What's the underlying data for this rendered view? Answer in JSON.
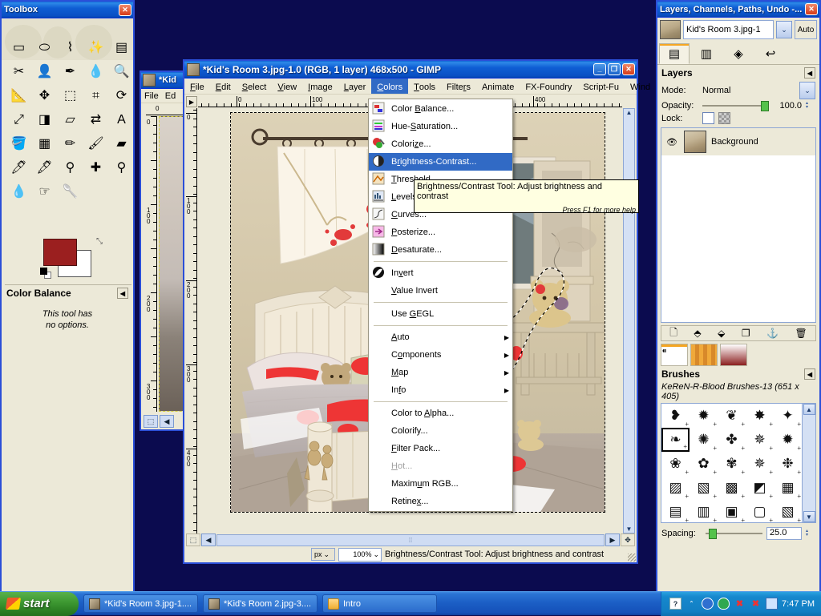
{
  "toolbox": {
    "title": "Toolbox",
    "close_label": "✕",
    "tools": [
      {
        "name": "rect-select-tool",
        "glyph": "▭"
      },
      {
        "name": "ellipse-select-tool",
        "glyph": "⬭"
      },
      {
        "name": "free-select-tool",
        "glyph": "⌇"
      },
      {
        "name": "fuzzy-select-tool",
        "glyph": "✨"
      },
      {
        "name": "select-by-color-tool",
        "glyph": "▤"
      },
      {
        "name": "scissors-select-tool",
        "glyph": "✂"
      },
      {
        "name": "foreground-select-tool",
        "glyph": "👤"
      },
      {
        "name": "paths-tool",
        "glyph": "✒"
      },
      {
        "name": "color-picker-tool",
        "glyph": "💧"
      },
      {
        "name": "zoom-tool",
        "glyph": "🔍"
      },
      {
        "name": "measure-tool",
        "glyph": "📐"
      },
      {
        "name": "move-tool",
        "glyph": "✥"
      },
      {
        "name": "align-tool",
        "glyph": "⬚"
      },
      {
        "name": "crop-tool",
        "glyph": "⌗"
      },
      {
        "name": "rotate-tool",
        "glyph": "⟳"
      },
      {
        "name": "scale-tool",
        "glyph": "⤢"
      },
      {
        "name": "shear-tool",
        "glyph": "◨"
      },
      {
        "name": "perspective-tool",
        "glyph": "▱"
      },
      {
        "name": "flip-tool",
        "glyph": "⇄"
      },
      {
        "name": "text-tool",
        "glyph": "A"
      },
      {
        "name": "bucket-fill-tool",
        "glyph": "🪣"
      },
      {
        "name": "blend-gradient-tool",
        "glyph": "▦"
      },
      {
        "name": "pencil-tool",
        "glyph": "✏"
      },
      {
        "name": "paintbrush-tool",
        "glyph": "🖌"
      },
      {
        "name": "eraser-tool",
        "glyph": "▰"
      },
      {
        "name": "airbrush-tool",
        "glyph": "🖊"
      },
      {
        "name": "ink-tool",
        "glyph": "🖋"
      },
      {
        "name": "clone-tool",
        "glyph": "⚲"
      },
      {
        "name": "heal-tool",
        "glyph": "✚"
      },
      {
        "name": "perspective-clone-tool",
        "glyph": "⚲"
      },
      {
        "name": "blur-sharpen-tool",
        "glyph": "💧"
      },
      {
        "name": "smudge-tool",
        "glyph": "☞"
      },
      {
        "name": "dodge-burn-tool",
        "glyph": "🥄"
      }
    ],
    "foreground_color": "#9b1f1f",
    "background_color": "#ffffff",
    "tool_options": {
      "title": "Color Balance",
      "empty_line1": "This tool has",
      "empty_line2": "no options.",
      "collapse_label": "◀"
    }
  },
  "background_window": {
    "title": "*Kid",
    "menu": [
      "File",
      "Ed"
    ],
    "ruler_h": [
      "0"
    ],
    "ruler_v": [
      "0",
      "100",
      "200",
      "300"
    ]
  },
  "gimp": {
    "title": "*Kid's Room 3.jpg-1.0 (RGB, 1 layer) 468x500 - GIMP",
    "window_buttons": {
      "minimize": "_",
      "maximize": "❐",
      "close": "✕"
    },
    "menubar": [
      {
        "label": "File",
        "accel": "F",
        "active": false
      },
      {
        "label": "Edit",
        "accel": "E",
        "active": false
      },
      {
        "label": "Select",
        "accel": "S",
        "active": false
      },
      {
        "label": "View",
        "accel": "V",
        "active": false
      },
      {
        "label": "Image",
        "accel": "I",
        "active": false
      },
      {
        "label": "Layer",
        "accel": "L",
        "active": false
      },
      {
        "label": "Colors",
        "accel": "C",
        "active": true
      },
      {
        "label": "Tools",
        "accel": "T",
        "active": false
      },
      {
        "label": "Filters",
        "accel": "r",
        "active": false
      },
      {
        "label": "Animate",
        "accel": "",
        "active": false
      },
      {
        "label": "FX-Foundry",
        "accel": "",
        "active": false
      },
      {
        "label": "Script-Fu",
        "accel": "",
        "active": false
      },
      {
        "label": "Wind",
        "accel": "",
        "active": false
      }
    ],
    "ruler_h_labels": [
      "0",
      "100",
      "400"
    ],
    "ruler_v_labels": [
      "0",
      "100",
      "200",
      "300",
      "400"
    ],
    "status": {
      "unit": "px",
      "zoom": "100%",
      "message": "Brightness/Contrast Tool: Adjust brightness and contrast"
    }
  },
  "colors_menu": {
    "items": [
      {
        "label": "Color Balance...",
        "accel": "B",
        "icon": "color-balance-icon",
        "type": "item"
      },
      {
        "label": "Hue-Saturation...",
        "accel": "S",
        "icon": "hue-saturation-icon",
        "type": "item"
      },
      {
        "label": "Colorize...",
        "accel": "z",
        "icon": "colorize-icon",
        "type": "item"
      },
      {
        "label": "Brightness-Contrast...",
        "accel": "r",
        "icon": "brightness-contrast-icon",
        "type": "item",
        "selected": true
      },
      {
        "label": "Threshold...",
        "accel": "T",
        "icon": "threshold-icon",
        "type": "item"
      },
      {
        "label": "Levels...",
        "accel": "L",
        "icon": "levels-icon",
        "type": "item"
      },
      {
        "label": "Curves...",
        "accel": "C",
        "icon": "curves-icon",
        "type": "item"
      },
      {
        "label": "Posterize...",
        "accel": "P",
        "icon": "posterize-icon",
        "type": "item"
      },
      {
        "label": "Desaturate...",
        "accel": "D",
        "icon": "desaturate-icon",
        "type": "item"
      },
      {
        "type": "separator"
      },
      {
        "label": "Invert",
        "accel": "v",
        "icon": "invert-icon",
        "type": "item"
      },
      {
        "label": "Value Invert",
        "accel": "V",
        "icon": "",
        "type": "item"
      },
      {
        "type": "separator"
      },
      {
        "label": "Use GEGL",
        "accel": "G",
        "icon": "",
        "type": "item"
      },
      {
        "type": "separator"
      },
      {
        "label": "Auto",
        "accel": "A",
        "icon": "",
        "type": "submenu"
      },
      {
        "label": "Components",
        "accel": "o",
        "icon": "",
        "type": "submenu"
      },
      {
        "label": "Map",
        "accel": "M",
        "icon": "",
        "type": "submenu"
      },
      {
        "label": "Info",
        "accel": "f",
        "icon": "",
        "type": "submenu"
      },
      {
        "type": "separator"
      },
      {
        "label": "Color to Alpha...",
        "accel": "A",
        "icon": "",
        "type": "item"
      },
      {
        "label": "Colorify...",
        "accel": "",
        "icon": "",
        "type": "item"
      },
      {
        "label": "Filter Pack...",
        "accel": "F",
        "icon": "",
        "type": "item"
      },
      {
        "label": "Hot...",
        "accel": "H",
        "icon": "",
        "type": "item",
        "disabled": true
      },
      {
        "label": "Maximum RGB...",
        "accel": "u",
        "icon": "",
        "type": "item"
      },
      {
        "label": "Retinex...",
        "accel": "x",
        "icon": "",
        "type": "item"
      }
    ],
    "submenu_arrow": "▶"
  },
  "tooltip": {
    "line1": "Brightness/Contrast Tool: Adjust brightness and contrast",
    "line2": "Press F1 for more help"
  },
  "dock": {
    "title": "Layers, Channels, Paths, Undo -...",
    "close_label": "✕",
    "image_name": "Kid's Room 3.jpg-1",
    "auto_label": "Auto",
    "dropdown_arrow": "⌄",
    "tabs": [
      {
        "name": "layers-tab",
        "glyph": "▤",
        "active": true
      },
      {
        "name": "channels-tab",
        "glyph": "▥",
        "active": false
      },
      {
        "name": "paths-tab",
        "glyph": "◈",
        "active": false
      },
      {
        "name": "undo-history-tab",
        "glyph": "↩",
        "active": false
      }
    ],
    "layers": {
      "title": "Layers",
      "collapse_label": "◀",
      "mode_label": "Mode:",
      "mode_value": "Normal",
      "opacity_label": "Opacity:",
      "opacity_value": "100.0",
      "lock_label": "Lock:",
      "items": [
        {
          "name": "Background",
          "visible": true
        }
      ],
      "buttons": [
        {
          "name": "new-layer-button",
          "glyph": "🗋"
        },
        {
          "name": "raise-layer-button",
          "glyph": "⬘"
        },
        {
          "name": "lower-layer-button",
          "glyph": "⬙"
        },
        {
          "name": "duplicate-layer-button",
          "glyph": "❐"
        },
        {
          "name": "anchor-layer-button",
          "glyph": "⚓"
        },
        {
          "name": "delete-layer-button",
          "glyph": "🗑"
        }
      ]
    },
    "brush_tabs": [
      {
        "name": "brushes-tab",
        "active": true
      },
      {
        "name": "patterns-tab",
        "active": false
      },
      {
        "name": "gradients-tab",
        "active": false
      }
    ],
    "brushes": {
      "title": "Brushes",
      "collapse_label": "◀",
      "selected_brush": "KeReN-R-Blood Brushes-13 (651 x 405)",
      "spacing_label": "Spacing:",
      "spacing_value": "25.0"
    }
  },
  "taskbar": {
    "start_label": "start",
    "buttons": [
      {
        "label": "*Kid's Room 3.jpg-1....",
        "icon": "gimp-icon",
        "active": false
      },
      {
        "label": "*Kid's Room 2.jpg-3....",
        "icon": "gimp-icon",
        "active": false
      },
      {
        "label": "Intro",
        "icon": "folder-icon",
        "active": false
      }
    ],
    "tray_icons": [
      "help-icon",
      "network-icon",
      "shield-icon",
      "volume-icon",
      "battery-icon",
      "monitor-icon"
    ],
    "clock": "7:47 PM"
  }
}
